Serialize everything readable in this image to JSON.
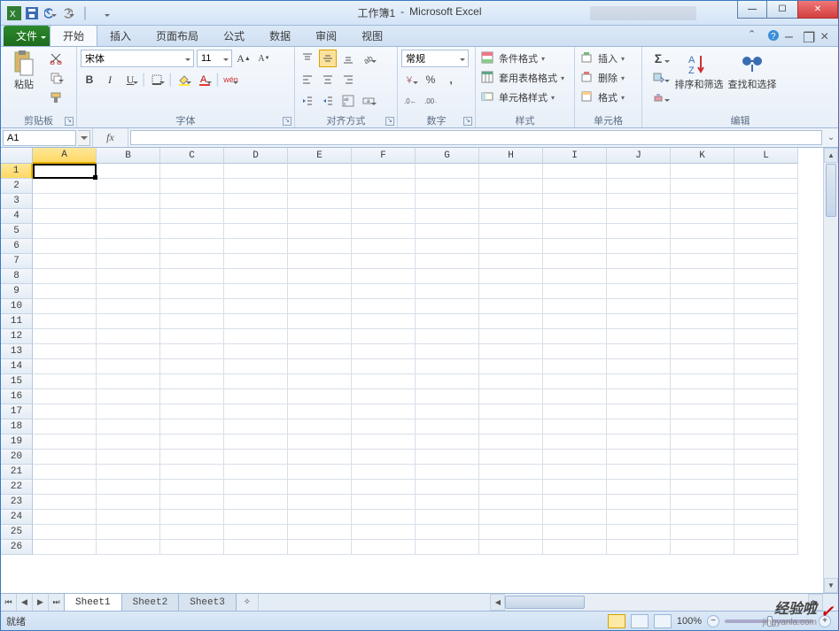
{
  "window": {
    "doc_title": "工作簿1",
    "app_title": "Microsoft Excel",
    "title_separator": "-"
  },
  "qat": {
    "excel_icon": "excel-icon",
    "save_icon": "save-icon",
    "undo_icon": "undo-icon",
    "redo_icon": "redo-icon"
  },
  "tabs": {
    "file": "文件",
    "items": [
      "开始",
      "插入",
      "页面布局",
      "公式",
      "数据",
      "审阅",
      "视图"
    ],
    "active_index": 0
  },
  "help_right": {
    "minimize_ribbon": "︿",
    "help": "?",
    "window_min": "–",
    "window_restore": "❐",
    "window_close": "×"
  },
  "ribbon": {
    "clipboard": {
      "label": "剪贴板",
      "paste": "粘贴",
      "cut_icon": "cut-icon",
      "copy_icon": "copy-icon",
      "format_painter_icon": "format-painter-icon"
    },
    "font": {
      "label": "字体",
      "font_name": "宋体",
      "font_size": "11",
      "bold": "B",
      "italic": "I",
      "underline": "U"
    },
    "alignment": {
      "label": "对齐方式"
    },
    "number": {
      "label": "数字",
      "format": "常规",
      "percent": "%",
      "comma": ","
    },
    "styles": {
      "label": "样式",
      "cond_format": "条件格式",
      "table_format": "套用表格格式",
      "cell_styles": "单元格样式"
    },
    "cells": {
      "label": "单元格",
      "insert": "插入",
      "delete": "删除",
      "format": "格式"
    },
    "editing": {
      "label": "编辑",
      "autosum": "Σ",
      "sort_filter": "排序和筛选",
      "find_select": "查找和选择"
    }
  },
  "formula_bar": {
    "name_box": "A1",
    "fx": "fx",
    "formula": ""
  },
  "grid": {
    "columns": [
      "A",
      "B",
      "C",
      "D",
      "E",
      "F",
      "G",
      "H",
      "I",
      "J",
      "K",
      "L"
    ],
    "rows": [
      1,
      2,
      3,
      4,
      5,
      6,
      7,
      8,
      9,
      10,
      11,
      12,
      13,
      14,
      15,
      16,
      17,
      18,
      19,
      20,
      21,
      22,
      23,
      24,
      25,
      26
    ],
    "selected_col_index": 0,
    "selected_row_index": 0
  },
  "sheets": {
    "tabs": [
      "Sheet1",
      "Sheet2",
      "Sheet3"
    ],
    "active_index": 0
  },
  "status": {
    "mode": "就绪",
    "zoom": "100%"
  },
  "watermark": {
    "brand": "经验啦",
    "domain": "jingyanla.com"
  }
}
